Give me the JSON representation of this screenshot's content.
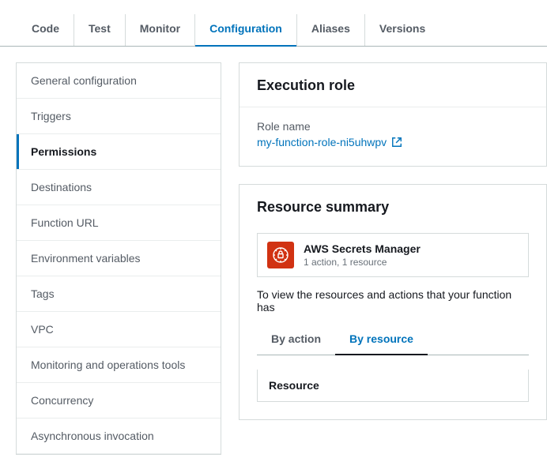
{
  "topTabs": {
    "items": [
      {
        "label": "Code"
      },
      {
        "label": "Test"
      },
      {
        "label": "Monitor"
      },
      {
        "label": "Configuration"
      },
      {
        "label": "Aliases"
      },
      {
        "label": "Versions"
      }
    ],
    "activeIndex": 3
  },
  "sidebar": {
    "items": [
      {
        "label": "General configuration"
      },
      {
        "label": "Triggers"
      },
      {
        "label": "Permissions"
      },
      {
        "label": "Destinations"
      },
      {
        "label": "Function URL"
      },
      {
        "label": "Environment variables"
      },
      {
        "label": "Tags"
      },
      {
        "label": "VPC"
      },
      {
        "label": "Monitoring and operations tools"
      },
      {
        "label": "Concurrency"
      },
      {
        "label": "Asynchronous invocation"
      }
    ],
    "activeIndex": 2
  },
  "executionRole": {
    "title": "Execution role",
    "fieldLabel": "Role name",
    "roleLink": "my-function-role-ni5uhwpv"
  },
  "resourceSummary": {
    "title": "Resource summary",
    "service": {
      "name": "AWS Secrets Manager",
      "meta": "1 action, 1 resource",
      "iconColor": "#d13212"
    },
    "description": "To view the resources and actions that your function has",
    "subTabs": {
      "items": [
        {
          "label": "By action"
        },
        {
          "label": "By resource"
        }
      ],
      "activeIndex": 1
    },
    "tableHeader": "Resource"
  }
}
